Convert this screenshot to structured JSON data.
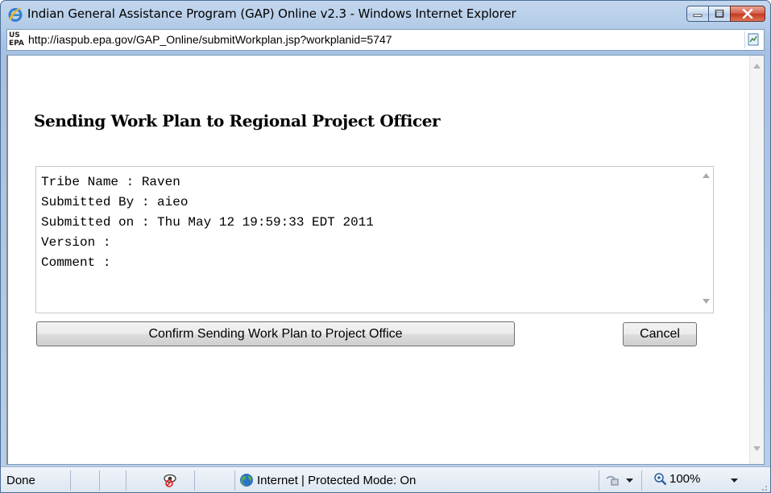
{
  "window": {
    "title": "Indian General Assistance Program (GAP) Online v2.3 - Windows Internet Explorer",
    "logo_icon": "internet-explorer-icon"
  },
  "address_bar": {
    "favicon_text_top": "US",
    "favicon_text_bottom": "EPA",
    "url": "http://iaspub.epa.gov/GAP_Online/submitWorkplan.jsp?workplanid=5747"
  },
  "page": {
    "heading": "Sending Work Plan to Regional Project Officer",
    "info_lines": [
      "Tribe Name : Raven",
      "Submitted By : aieo",
      "Submitted on : Thu May 12 19:59:33 EDT 2011",
      "Version :",
      "Comment :"
    ],
    "confirm_button": "Confirm Sending Work Plan to Project Office",
    "cancel_button": "Cancel"
  },
  "status_bar": {
    "status": "Done",
    "zone": "Internet | Protected Mode: On",
    "zoom": "100%"
  },
  "colors": {
    "titlebar": "#b9cfe9",
    "close_button": "#c2391f",
    "page_background": "#ffffff"
  }
}
